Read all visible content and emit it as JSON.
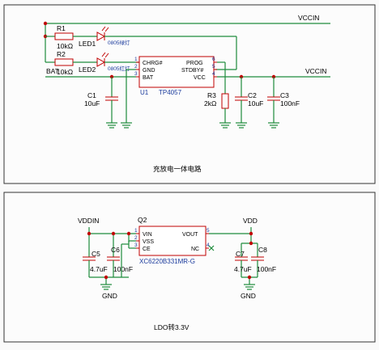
{
  "sheet1": {
    "title": "充放电一体电路",
    "nets": {
      "vccin_top": "VCCIN",
      "vccin_right": "VCCIN",
      "bat": "BAT"
    },
    "r1": {
      "ref": "R1",
      "value": "10kΩ"
    },
    "r2": {
      "ref": "R2",
      "value": "10kΩ"
    },
    "led1": {
      "ref": "LED1",
      "pkg": "0805绿灯"
    },
    "led2": {
      "ref": "LED2",
      "pkg": "0805红灯"
    },
    "u1": {
      "ref": "U1",
      "part": "TP4057",
      "pins_left": [
        "CHRG#",
        "GND",
        "BAT"
      ],
      "pins_left_num": [
        "1",
        "2",
        "3"
      ],
      "pins_right": [
        "PROG",
        "STDBY#",
        "VCC"
      ],
      "pins_right_num": [
        "6",
        "5",
        "4"
      ]
    },
    "c1": {
      "ref": "C1",
      "value": "10uF"
    },
    "r3": {
      "ref": "R3",
      "value": "2kΩ"
    },
    "c2": {
      "ref": "C2",
      "value": "10uF"
    },
    "c3": {
      "ref": "C3",
      "value": "100nF"
    }
  },
  "sheet2": {
    "title": "LDO转3.3V",
    "nets": {
      "vddin": "VDDIN",
      "vdd": "VDD",
      "gnd_left": "GND",
      "gnd_right": "GND"
    },
    "q2": {
      "ref": "Q2",
      "part": "XC6220B331MR-G",
      "pins_left": [
        "VIN",
        "VSS",
        "CE"
      ],
      "pins_left_num": [
        "1",
        "2",
        "3"
      ],
      "pins_right": [
        "VOUT",
        "NC"
      ],
      "pins_right_num": [
        "5",
        "4"
      ]
    },
    "c5": {
      "ref": "C5",
      "value": "4.7uF"
    },
    "c6": {
      "ref": "C6",
      "value": "100nF"
    },
    "c7": {
      "ref": "C7",
      "value": "4.7uF"
    },
    "c8": {
      "ref": "C8",
      "value": "100nF"
    }
  }
}
